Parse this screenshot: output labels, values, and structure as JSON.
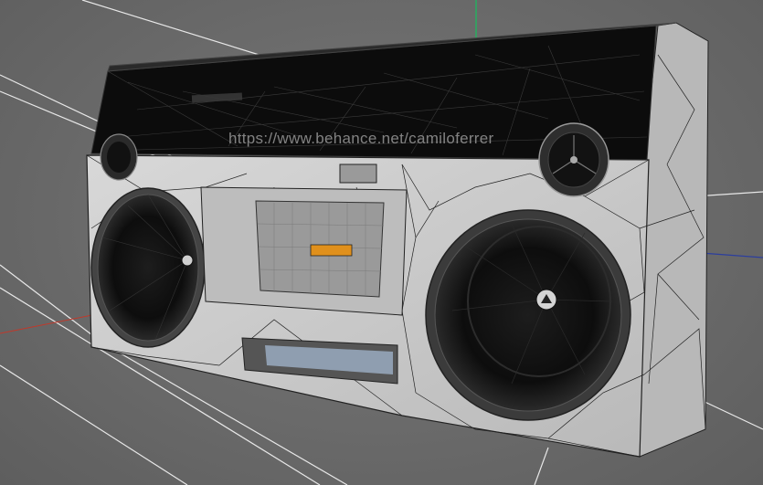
{
  "watermark": "https://www.behance.net/camiloferrer",
  "colors": {
    "background": "#6b6b6b",
    "shell": "#c9c9c9",
    "wire": "#1a1a1a",
    "axis_x": "#c0392b",
    "axis_y": "#27ae60",
    "axis_z": "#2c3e9e",
    "accent": "#e0901c"
  },
  "objects": [
    {
      "name": "boombox-body",
      "icon": "mesh-icon"
    },
    {
      "name": "left-woofer",
      "icon": "speaker-icon"
    },
    {
      "name": "right-woofer",
      "icon": "speaker-icon"
    },
    {
      "name": "left-tweeter",
      "icon": "speaker-icon"
    },
    {
      "name": "right-tweeter",
      "icon": "speaker-icon"
    },
    {
      "name": "cassette-deck",
      "icon": "cassette-icon"
    }
  ]
}
